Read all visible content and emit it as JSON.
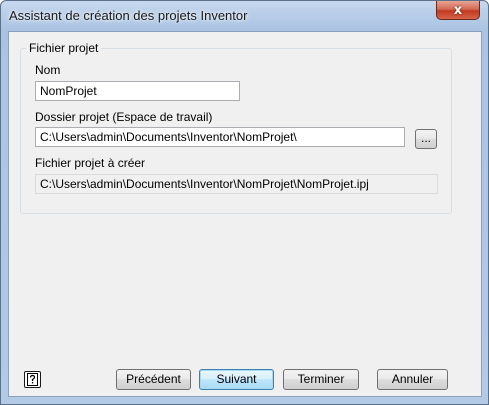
{
  "window": {
    "title": "Assistant de création des projets Inventor",
    "close_glyph": "x"
  },
  "group": {
    "legend": "Fichier projet"
  },
  "fields": {
    "name_label": "Nom",
    "name_value": "NomProjet",
    "folder_label": "Dossier projet (Espace de travail)",
    "folder_value": "C:\\Users\\admin\\Documents\\Inventor\\NomProjet\\",
    "browse_label": "...",
    "file_label": "Fichier projet à créer",
    "file_value": "C:\\Users\\admin\\Documents\\Inventor\\NomProjet\\NomProjet.ipj"
  },
  "buttons": {
    "help_icon": "help-icon",
    "previous": "Précédent",
    "next": "Suivant",
    "finish": "Terminer",
    "cancel": "Annuler"
  }
}
